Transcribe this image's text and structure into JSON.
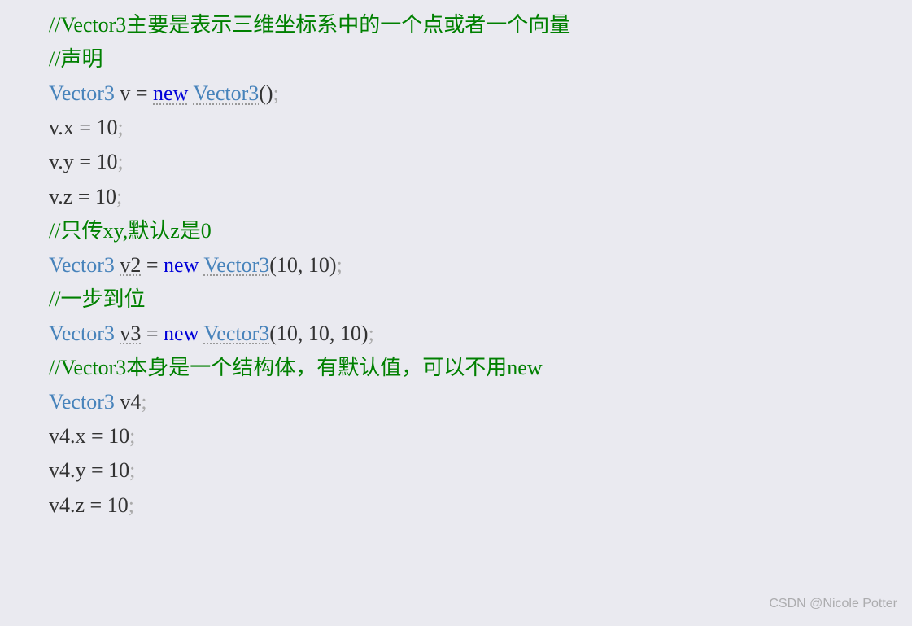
{
  "lines": {
    "l0_comment": "//Vector3主要是表示三维坐标系中的一个点或者一个向量",
    "l1_comment": "//声明",
    "l2_type1": "Vector3",
    "l2_var": " v ",
    "l2_eq": "= ",
    "l2_new": "new",
    "l2_sp": " ",
    "l2_ctor": "Vector3",
    "l2_paren": "()",
    "l2_semi": ";",
    "l3_txt": "v.x ",
    "l3_eq": "= ",
    "l3_num": "10",
    "l3_semi": ";",
    "l4_txt": "v.y ",
    "l4_eq": "= ",
    "l4_num": "10",
    "l4_semi": ";",
    "l5_txt": "v.z ",
    "l5_eq": "= ",
    "l5_num": "10",
    "l5_semi": ";",
    "l6_comment": "//只传xy,默认z是0",
    "l7_type1": "Vector3",
    "l7_sp1": " ",
    "l7_var": "v2",
    "l7_sp2": " ",
    "l7_eq": "= ",
    "l7_new": "new",
    "l7_sp3": " ",
    "l7_ctor": "Vector3",
    "l7_paren": "(10, 10)",
    "l7_semi": ";",
    "l8_comment": "//一步到位",
    "l9_type1": "Vector3",
    "l9_sp1": " ",
    "l9_var": "v3",
    "l9_sp2": " ",
    "l9_eq": "= ",
    "l9_new": "new",
    "l9_sp3": " ",
    "l9_ctor": "Vector3",
    "l9_paren": "(10, 10, 10)",
    "l9_semi": ";",
    "l10_comment": "//Vector3本身是一个结构体，有默认值，可以不用new",
    "l11_type1": "Vector3",
    "l11_var": " v4",
    "l11_semi": ";",
    "l12_txt": "v4.x ",
    "l12_eq": "= ",
    "l12_num": "10",
    "l12_semi": ";",
    "l13_txt": "v4.y ",
    "l13_eq": "= ",
    "l13_num": "10",
    "l13_semi": ";",
    "l14_txt": "v4.z ",
    "l14_eq": "= ",
    "l14_num": "10",
    "l14_semi": ";"
  },
  "watermark": "CSDN @Nicole Potter"
}
